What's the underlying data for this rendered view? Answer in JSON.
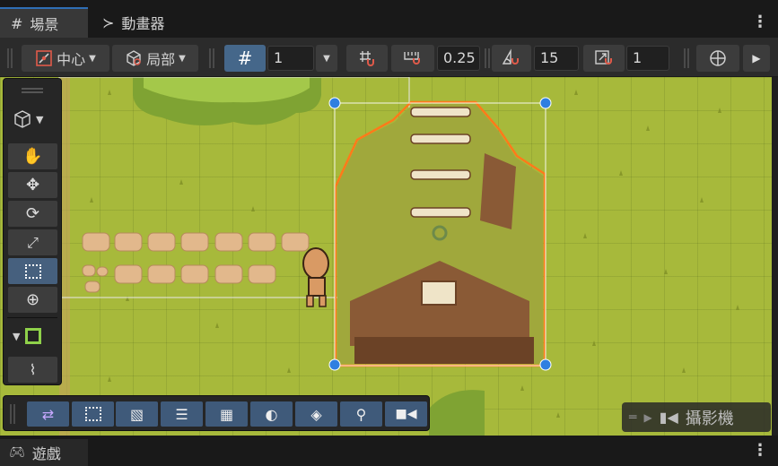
{
  "tabs": {
    "scene": "場景",
    "animator": "動畫器",
    "game": "遊戲"
  },
  "toolbar": {
    "pivot_label": "中心",
    "space_label": "局部",
    "grid_size": "1",
    "move_snap": "0.25",
    "rotate_snap": "15",
    "scale_snap": "1"
  },
  "scene_view": {
    "camera_overlay_label": "攝影機"
  },
  "colors": {
    "accent": "#2f6fb5",
    "selection_outline": "#ff7a1a",
    "handle": "#2f7fe0",
    "grass": "#a7b93b"
  },
  "icons": {
    "tools": [
      "hand-icon",
      "move-icon",
      "rotate-icon",
      "scale-icon",
      "rect-icon",
      "transform-icon"
    ],
    "bottom": [
      "shuffle-icon",
      "rect-select-icon",
      "sprite-icon",
      "layers-icon",
      "grid-hatch-icon",
      "moon-icon",
      "tile-icon",
      "zoom-icon",
      "camera-icon"
    ]
  }
}
